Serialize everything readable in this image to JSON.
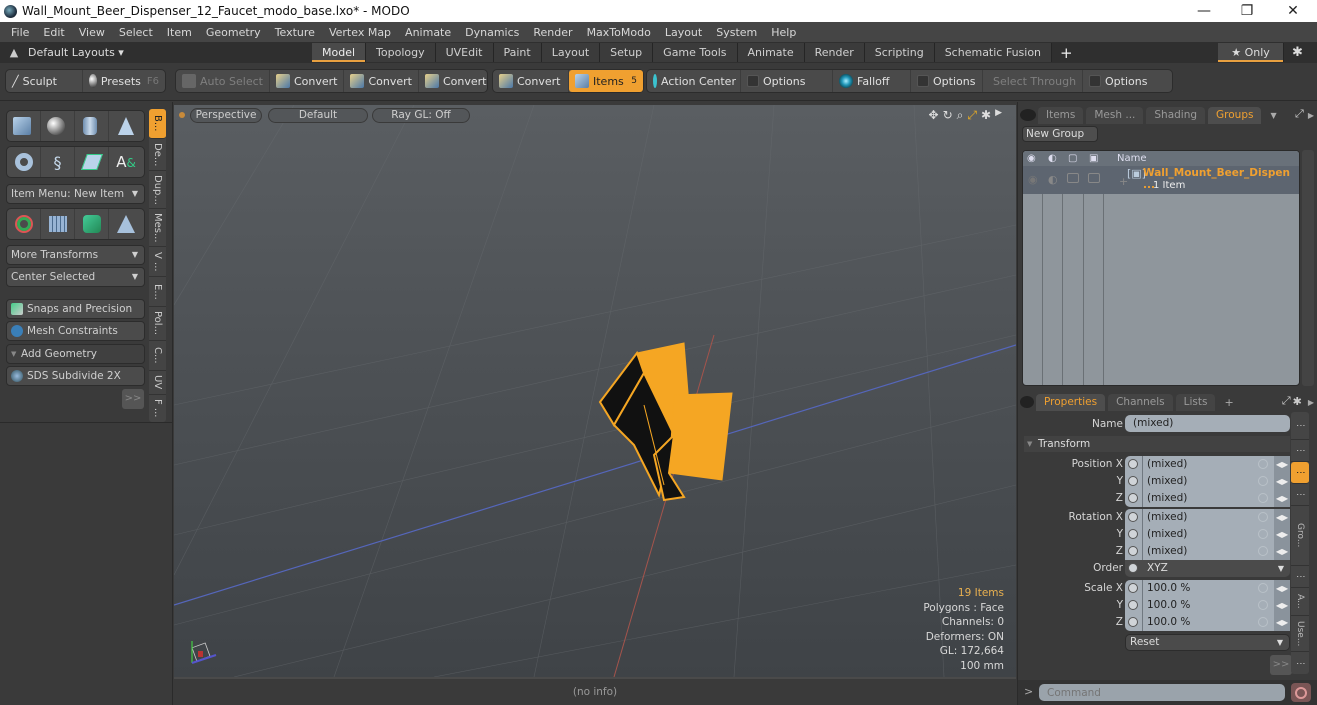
{
  "window": {
    "title": "Wall_Mount_Beer_Dispenser_12_Faucet_modo_base.lxo* - MODO",
    "minimize": "—",
    "maximize": "❐",
    "close": "✕"
  },
  "menu": [
    "File",
    "Edit",
    "View",
    "Select",
    "Item",
    "Geometry",
    "Texture",
    "Vertex Map",
    "Animate",
    "Dynamics",
    "Render",
    "MaxToModo",
    "Layout",
    "System",
    "Help"
  ],
  "layoutbar": {
    "layouts_label": "Default Layouts ▾",
    "tabs": [
      "Model",
      "Topology",
      "UVEdit",
      "Paint",
      "Layout",
      "Setup",
      "Game Tools",
      "Animate",
      "Render",
      "Scripting",
      "Schematic Fusion"
    ],
    "active_tab": "Model",
    "add": "+",
    "only_label": "★ Only",
    "gear": "✱"
  },
  "toolbar": {
    "sculpt": "Sculpt",
    "presets": "Presets",
    "presets_key": "F6",
    "auto_select": "Auto Select",
    "convert1": "Convert",
    "convert2": "Convert",
    "convert3": "Convert",
    "convert4": "Convert",
    "items": "Items",
    "items_key": "5",
    "action_center": "Action Center",
    "options1": "Options",
    "falloff": "Falloff",
    "options2": "Options",
    "select_through": "Select Through",
    "options3": "Options"
  },
  "leftpanel": {
    "item_menu": "Item Menu: New Item",
    "more_transforms": "More Transforms",
    "center_selected": "Center Selected",
    "snaps": "Snaps and Precision",
    "mesh_constraints": "Mesh Constraints",
    "add_geometry": "Add Geometry",
    "sds": "SDS Subdivide 2X",
    "more": ">>",
    "vtabs": [
      "B...",
      "De...",
      "Dup...",
      "Mes...",
      "V ...",
      "E...",
      "Pol...",
      "C...",
      "UV",
      "F ..."
    ]
  },
  "viewport": {
    "view": "Perspective",
    "shading": "Default",
    "raygl": "Ray GL: Off",
    "stats": {
      "items": "19 Items",
      "polygons": "Polygons : Face",
      "channels": "Channels: 0",
      "deformers": "Deformers: ON",
      "gl": "GL: 172,664",
      "unit": "100 mm"
    },
    "status": "(no info)"
  },
  "groups_panel": {
    "tabs": [
      "Items",
      "Mesh ...",
      "Shading",
      "Groups"
    ],
    "active_tab": "Groups",
    "new_group": "New Group",
    "col_name": "Name",
    "row_name": "Wall_Mount_Beer_Dispen ...",
    "row_sub": "1 Item"
  },
  "properties": {
    "tabs": [
      "Properties",
      "Channels",
      "Lists"
    ],
    "active_tab": "Properties",
    "add": "+",
    "name_label": "Name",
    "name_value": "(mixed)",
    "section": "Transform",
    "pos_label": "Position X",
    "rot_label": "Rotation X",
    "scale_label": "Scale X",
    "y": "Y",
    "z": "Z",
    "pos": [
      "(mixed)",
      "(mixed)",
      "(mixed)"
    ],
    "rot": [
      "(mixed)",
      "(mixed)",
      "(mixed)"
    ],
    "order_label": "Order",
    "order_value": "XYZ",
    "scale": [
      "100.0 %",
      "100.0 %",
      "100.0 %"
    ],
    "reset": "Reset",
    "more": ">>",
    "side_tabs": [
      "⋮",
      "⋮",
      "⋮",
      "⋮",
      "Gro...",
      "⋮",
      "A...",
      "Use...",
      "⋮"
    ]
  },
  "command": {
    "prompt": ">",
    "placeholder": "Command"
  },
  "colors": {
    "accent": "#f0a030",
    "selected_mesh": "#f5a623"
  }
}
